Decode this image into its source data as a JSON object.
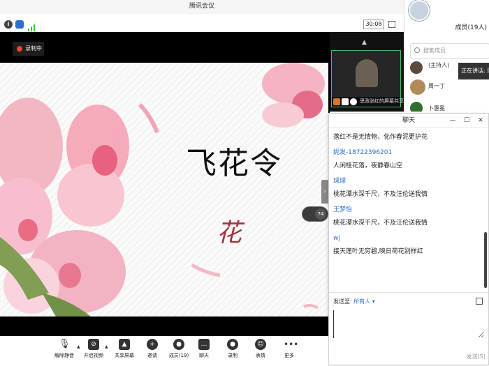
{
  "window": {
    "title": "腾讯会议"
  },
  "info": {
    "timer": "30:08"
  },
  "recording": {
    "label": "录制中"
  },
  "slide": {
    "title": "飞花令",
    "char": "花",
    "speaker_level": "74"
  },
  "video_strip": {
    "label": "思政张红的屏幕共享"
  },
  "members": {
    "title": "成员(19人)",
    "search_placeholder": "搜索成员",
    "items": [
      {
        "name": "(主持人)"
      },
      {
        "name": "周一丁"
      },
      {
        "name": "卜惠冕"
      }
    ],
    "speaking": "正在讲话: 周"
  },
  "chat": {
    "title": "聊天",
    "messages": [
      {
        "name": "",
        "text": "落红不是无情物，化作春泥更护花"
      },
      {
        "name": "妮发-18722396201",
        "text": "人闲桂花落，夜静春山空"
      },
      {
        "name": "球球",
        "text": "桃花潭水深千尺，不及汪伦送我情"
      },
      {
        "name": "王梦怡",
        "text": "桃花潭水深千尺，不及汪伦送我情"
      },
      {
        "name": "wj",
        "text": "接天莲叶无穷碧,映日荷花别样红"
      }
    ],
    "send_to_label": "发送至:",
    "send_to_target": "所有人",
    "send_label": "发送(S)"
  },
  "toolbar": {
    "items": [
      {
        "label": "解除静音",
        "icon": "mic-off-icon"
      },
      {
        "label": "开启视频",
        "icon": "video-off-icon"
      },
      {
        "label": "共享屏幕",
        "icon": "share-screen-icon"
      },
      {
        "label": "邀请",
        "icon": "invite-icon"
      },
      {
        "label": "成员(19)",
        "icon": "members-icon"
      },
      {
        "label": "聊天",
        "icon": "chat-icon"
      },
      {
        "label": "录制",
        "icon": "record-icon"
      },
      {
        "label": "表情",
        "icon": "emoji-icon"
      },
      {
        "label": "更多",
        "icon": "more-icon"
      }
    ]
  },
  "colors": {
    "accent": "#2a6fd1",
    "slide_char": "#a3333a",
    "record": "#e43"
  }
}
